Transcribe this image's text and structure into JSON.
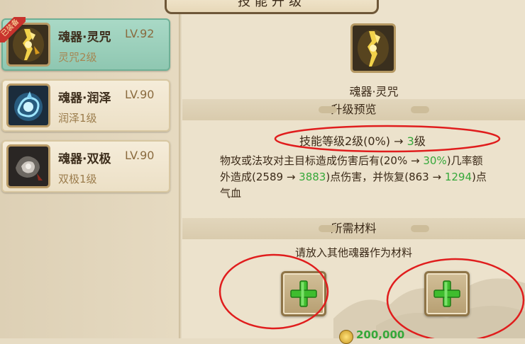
{
  "title": "技能升级",
  "skills": [
    {
      "name": "魂器·灵咒",
      "level": "LV.92",
      "sub": "灵咒2级",
      "selected": true,
      "badge": "已装备"
    },
    {
      "name": "魂器·润泽",
      "level": "LV.90",
      "sub": "润泽1级",
      "selected": false
    },
    {
      "name": "魂器·双极",
      "level": "LV.90",
      "sub": "双极1级",
      "selected": false
    }
  ],
  "detail": {
    "skill_name": "魂器·灵咒",
    "preview_header": "升级预览",
    "level_prefix": "技能等级2级(0%)",
    "arrow": "→",
    "level_new": "3",
    "level_suffix": "级",
    "desc": {
      "l1_a": "物攻或法攻对主目标造成伤害后有(20%",
      "l1_arrow": "→",
      "l1_new": "30%",
      "l1_b": ")几率额",
      "l2_a": "外造成(2589",
      "l2_arrow": "→",
      "l2_new": "3883",
      "l2_b": ")点伤害，并恢复(863",
      "l2_arrow2": "→",
      "l2_new2": "1294",
      "l2_c": ")点",
      "l3": "气血"
    },
    "materials_header": "所需材料",
    "materials_hint": "请放入其他魂器作为材料",
    "cost": "200,000"
  },
  "colors": {
    "accent_green": "#36a83a",
    "annotation_red": "#e01d1d",
    "selected_bg": "#9fd2be"
  }
}
